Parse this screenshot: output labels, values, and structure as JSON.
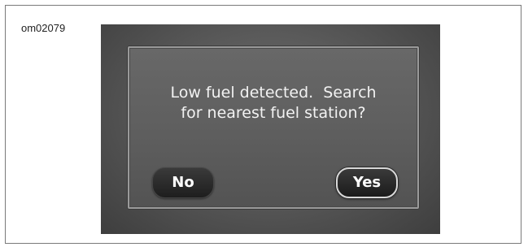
{
  "figure_id": "om02079",
  "dialog": {
    "message_lines": [
      "Low fuel detected.  Search",
      "for nearest fuel station?"
    ],
    "no_label": "No",
    "yes_label": "Yes"
  }
}
